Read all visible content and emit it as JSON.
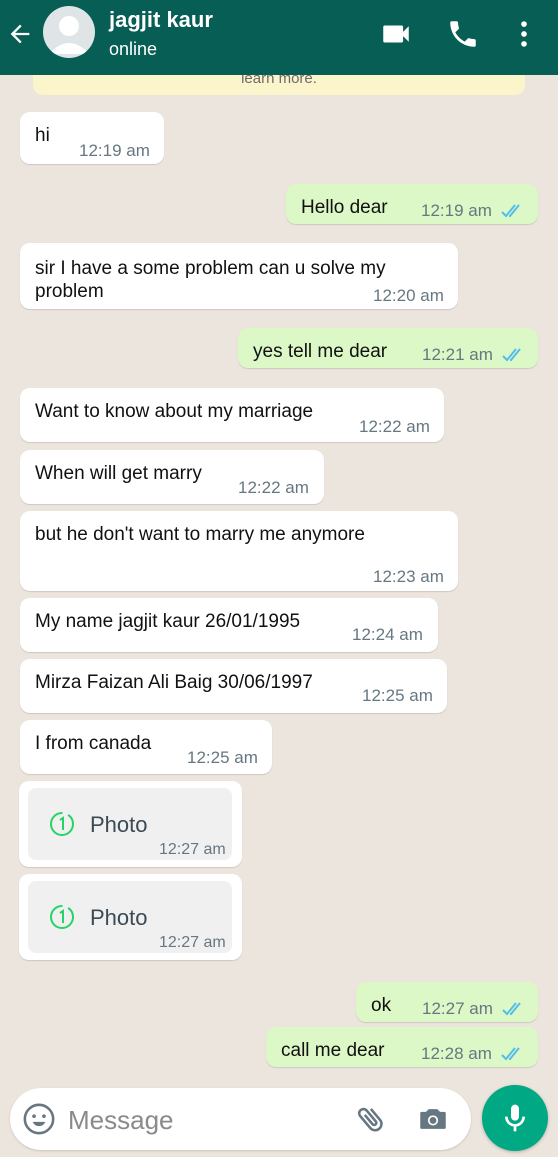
{
  "header": {
    "name": "jagjit kaur",
    "status": "online"
  },
  "notice_text": "learn more.",
  "messages": [
    {
      "text": "hi",
      "time": "12:19 am"
    },
    {
      "text": "Hello dear",
      "time": "12:19 am"
    },
    {
      "text": "sir I have a some problem can u solve my problem",
      "time": "12:20 am"
    },
    {
      "text": "yes tell me dear",
      "time": "12:21 am"
    },
    {
      "text": "Want to know about my marriage",
      "time": "12:22 am"
    },
    {
      "text": "When will get marry",
      "time": "12:22 am"
    },
    {
      "text": "but he don't want to marry me anymore",
      "time": "12:23 am"
    },
    {
      "text": "My name jagjit kaur 26/01/1995",
      "time": "12:24 am"
    },
    {
      "text": "Mirza Faizan Ali Baig 30/06/1997",
      "time": "12:25 am"
    },
    {
      "text": "I from canada",
      "time": "12:25 am"
    },
    {
      "text": "Photo",
      "time": "12:27 am"
    },
    {
      "text": "Photo",
      "time": "12:27 am"
    },
    {
      "text": "ok",
      "time": "12:27 am"
    },
    {
      "text": "call me dear",
      "time": "12:28 am"
    }
  ],
  "input": {
    "placeholder": "Message"
  },
  "colors": {
    "header": "#075e54",
    "outgoing_bubble": "#dcf8c6",
    "incoming_bubble": "#ffffff",
    "read_ticks": "#53bdeb",
    "mic_button": "#00a884",
    "chat_background": "#ece5dd"
  },
  "icons": [
    "back-arrow-icon",
    "avatar-icon",
    "video-call-icon",
    "voice-call-icon",
    "more-options-icon",
    "view-once-icon",
    "emoji-icon",
    "attach-icon",
    "camera-icon",
    "mic-icon",
    "read-ticks-icon"
  ]
}
